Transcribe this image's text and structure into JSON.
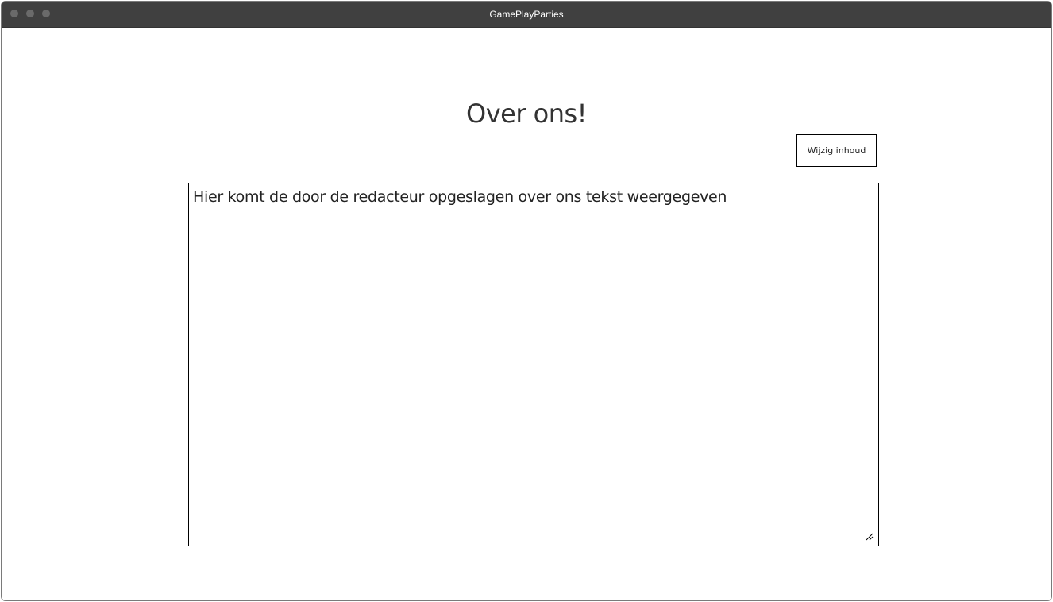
{
  "window": {
    "title": "GamePlayParties"
  },
  "page": {
    "title": "Over ons!",
    "edit_button_label": "Wijzig inhoud",
    "content_text": "Hier komt de door de redacteur opgeslagen over ons tekst weergegeven"
  },
  "colors": {
    "titlebar": "#404040",
    "traffic_light": "#6a6a6a",
    "border": "#000000"
  }
}
